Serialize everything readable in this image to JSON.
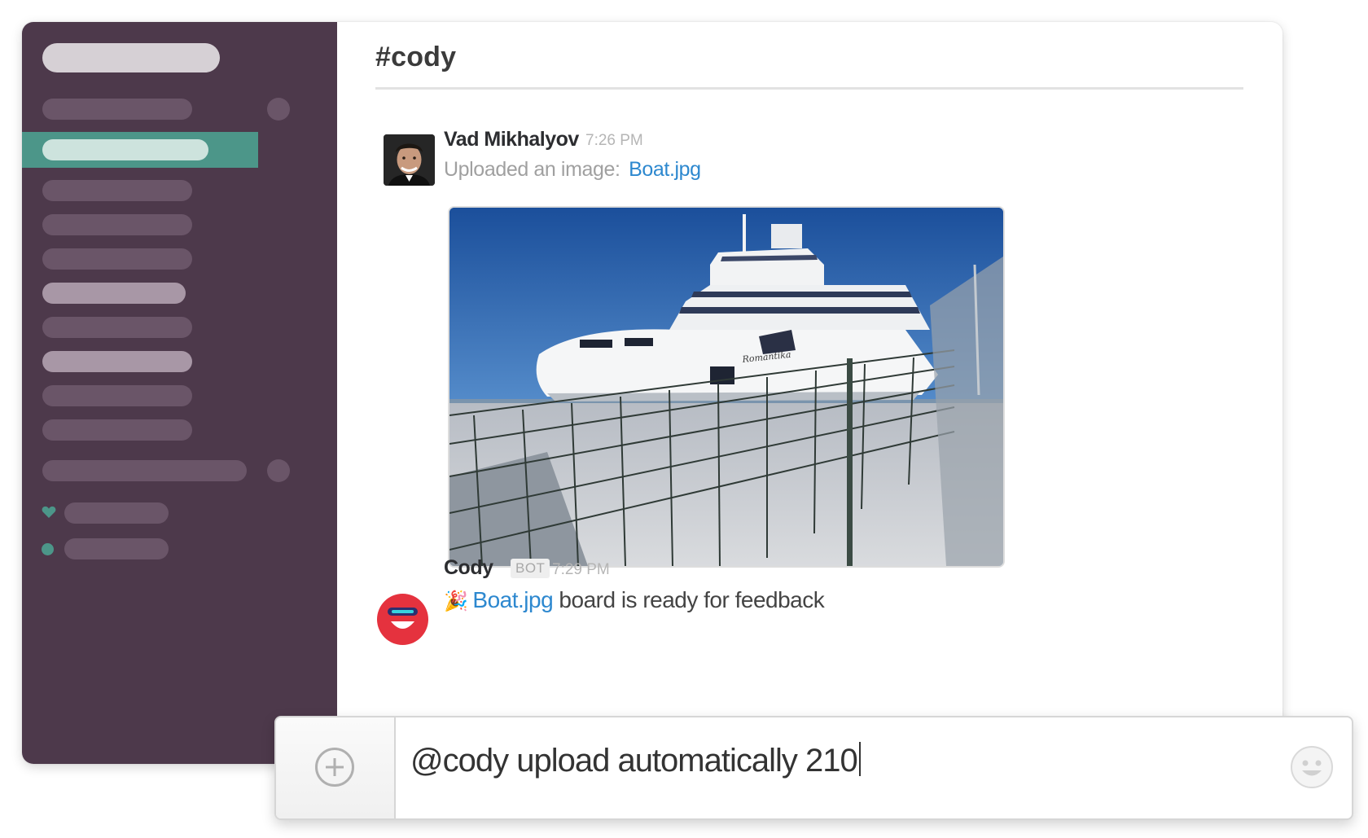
{
  "channel": {
    "name": "#cody"
  },
  "messages": [
    {
      "author": "Vad Mikhalyov",
      "time": "7:26 PM",
      "text_prefix": "Uploaded an image:",
      "link": "Boat.jpg",
      "attachment": {
        "ship_name": "Romantika"
      }
    },
    {
      "author": "Cody",
      "badge": "BOT",
      "time": "7:29 PM",
      "emoji": "🎉",
      "link": "Boat.jpg",
      "text_suffix": "board is ready for feedback"
    }
  ],
  "composer": {
    "value": "@cody upload automatically 210"
  },
  "colors": {
    "sidebar": "#4d394b",
    "active_item": "#4c9689",
    "link": "#2d88cf",
    "bot_avatar": "#e5323e"
  },
  "icons": {
    "add": "plus-circle-icon",
    "emoji": "smiley-icon",
    "presence": "heart-icon"
  }
}
